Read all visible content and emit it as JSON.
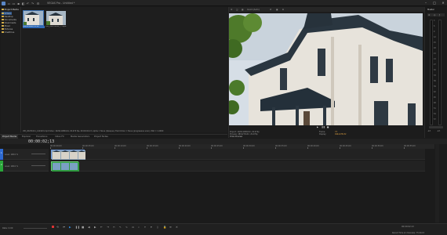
{
  "window": {
    "title": "VEGAS Pro - Untitled *",
    "menu_icons": [
      "app-icon",
      "new-icon",
      "open-icon",
      "save-icon",
      "render-icon",
      "undo-icon",
      "redo-icon",
      "settings-icon"
    ]
  },
  "explorer": {
    "path_label": "Project Media",
    "tree_items": [
      "Videos",
      "Desktop",
      "Documents",
      "Downloads",
      "Music",
      "Pictures",
      "OneDrive"
    ]
  },
  "media": {
    "items": [
      {
        "name": "1920x1080 HEVC",
        "selected": true
      },
      {
        "name": "VID_20231011_...mp4",
        "selected": false
      }
    ],
    "status_text": "VID_20231011_141923.mp4  Video: 1920x1080x24, 29.970 fps, 00:00:02;13, Alpha = None (Opaque), Field Order = None (progressive scan), PAR = 1.0000"
  },
  "panel_tabs": [
    "Project Media",
    "Explorer",
    "Transitions",
    "Video FX",
    "Media Generators",
    "Project Notes"
  ],
  "preview": {
    "toolbar_label": "Good (Auto)",
    "project_info": "Project:   1920x1080x32, 29.970p",
    "preview_info": "Preview:   480x270x32, 29.970p",
    "video_preview_label": "Video Preview",
    "frame_label": "Frame:",
    "frame_value": "73",
    "display_label": "Display:",
    "display_value": "494x278x32"
  },
  "master": {
    "label": "Master",
    "scale": [
      "3",
      "6",
      "9",
      "12",
      "15",
      "18",
      "21",
      "24",
      "27",
      "30",
      "33",
      "36",
      "39",
      "42",
      "45",
      "48",
      "51",
      "54",
      "57"
    ],
    "readout_l": "-Inf.",
    "readout_r": "-Inf."
  },
  "timeline": {
    "timecode": "00:00:02;13",
    "ruler_marks": [
      "00:00:00;00",
      "00:00:05;00",
      "00:00:10;00",
      "00:00:15;00",
      "00:00:20;00",
      "00:00:25;00",
      "00:00:30;00",
      "00:00:35;00",
      "00:00:40;00",
      "00:00:45;00",
      "00:00:50;00",
      "00:00:55;00"
    ],
    "tracks": [
      {
        "number": "1",
        "label": "Level: 100.0 %",
        "color": "#2e6ad1"
      },
      {
        "number": "2",
        "label": "Level: 100.0 %",
        "color": "#2aa63a"
      }
    ]
  },
  "bottom": {
    "rate_label": "Rate: 0.00",
    "timecode_end": "00:00:02;13",
    "record_time": "Record Time (2 channels): 75:24:15"
  },
  "colors": {
    "accent": "#2f8be0",
    "track_video": "#2e6ad1",
    "track_audio": "#2aa63a",
    "panel_bg": "#1f1f1f"
  }
}
